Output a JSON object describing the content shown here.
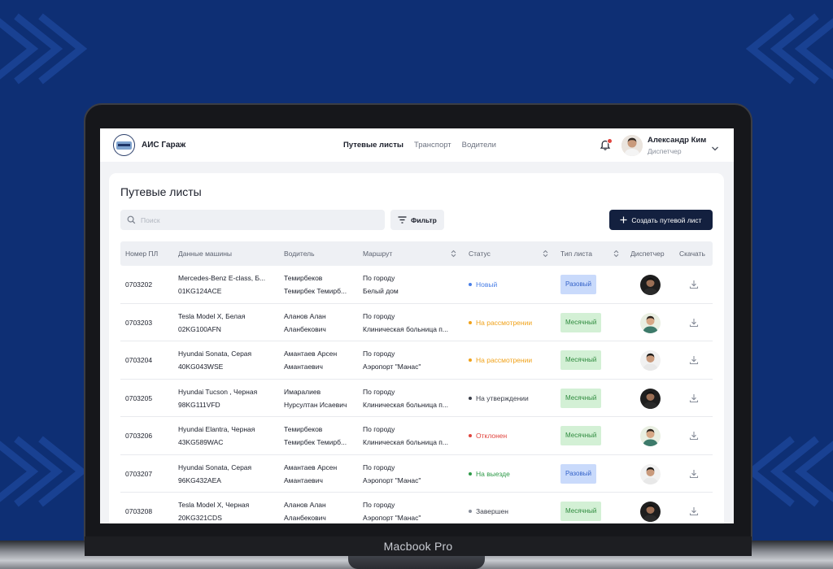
{
  "app": {
    "brand": "АИС Гараж",
    "device_label": "Macbook Pro"
  },
  "nav": [
    {
      "label": "Путевые листы",
      "active": true
    },
    {
      "label": "Транспорт",
      "active": false
    },
    {
      "label": "Водители",
      "active": false
    }
  ],
  "user": {
    "name": "Александр Ким",
    "role": "Диспетчер"
  },
  "page": {
    "title": "Путевые листы",
    "search_placeholder": "Поиск",
    "filter_label": "Фильтр",
    "create_label": "Создать путевой лист"
  },
  "table": {
    "headers": {
      "number": "Номер ПЛ",
      "car": "Данные машины",
      "driver": "Водитель",
      "route": "Маршрут",
      "status": "Статус",
      "sheet_type": "Тип листа",
      "dispatcher": "Диспетчер",
      "download": "Скачать"
    },
    "rows": [
      {
        "number": "0703202",
        "car": "Mercedes-Benz E-class, Б...",
        "plate": "01KG124ACE",
        "driver1": "Темирбеков",
        "driver2": "Темирбек Темирб...",
        "route1": "По городу",
        "route2": "Белый дом",
        "status": "Новый",
        "status_color": "#4a7fe6",
        "sheet_type": "Разовый",
        "sheet_kind": "one-time"
      },
      {
        "number": "0703203",
        "car": "Tesla Model X, Белая",
        "plate": "02KG100AFN",
        "driver1": "Аланов Алан",
        "driver2": "Аланбекович",
        "route1": "По городу",
        "route2": "Клиническая больница п...",
        "status": "На рассмотрении",
        "status_color": "#f0a21a",
        "sheet_type": "Месячный",
        "sheet_kind": "monthly"
      },
      {
        "number": "0703204",
        "car": "Hyundai Sonata, Серая",
        "plate": "40KG043WSE",
        "driver1": "Амантаев Арсен",
        "driver2": "Амантаевич",
        "route1": "По городу",
        "route2": "Аэропорт \"Манас\"",
        "status": "На рассмотрении",
        "status_color": "#f0a21a",
        "sheet_type": "Месячный",
        "sheet_kind": "monthly"
      },
      {
        "number": "0703205",
        "car": "Hyundai Tucson , Черная",
        "plate": "98KG111VFD",
        "driver1": "Имаралиев",
        "driver2": "Нурсултан Исаевич",
        "route1": "По городу",
        "route2": "Клиническая больница п...",
        "status": "На утверждении",
        "status_color": "#3b3f4a",
        "sheet_type": "Месячный",
        "sheet_kind": "monthly"
      },
      {
        "number": "0703206",
        "car": "Hyundai Elantra, Черная",
        "plate": "43KG589WAC",
        "driver1": "Темирбеков",
        "driver2": "Темирбек Темирб...",
        "route1": "По городу",
        "route2": "Клиническая больница п...",
        "status": "Отклонен",
        "status_color": "#e0443e",
        "sheet_type": "Месячный",
        "sheet_kind": "monthly"
      },
      {
        "number": "0703207",
        "car": "Hyundai Sonata, Серая",
        "plate": "96KG432AEA",
        "driver1": "Амантаев Арсен",
        "driver2": "Амантаевич",
        "route1": "По городу",
        "route2": "Аэропорт \"Манас\"",
        "status": "На выезде",
        "status_color": "#2e9a48",
        "sheet_type": "Разовый",
        "sheet_kind": "one-time"
      },
      {
        "number": "0703208",
        "car": "Tesla Model X, Черная",
        "plate": "20KG321CDS",
        "driver1": "Аланов Алан",
        "driver2": "Аланбекович",
        "route1": "По городу",
        "route2": "Аэропорт \"Манас\"",
        "status": "Завершен",
        "status_color": "#8a909c",
        "sheet_type": "Месячный",
        "sheet_kind": "monthly"
      }
    ]
  },
  "colors": {
    "background": "#0e2f74",
    "primary_button": "#13203f",
    "badge_one_time_bg": "#c9dafb",
    "badge_one_time_fg": "#3563c9",
    "badge_monthly_bg": "#d3f0d5",
    "badge_monthly_fg": "#2e8a3d"
  }
}
